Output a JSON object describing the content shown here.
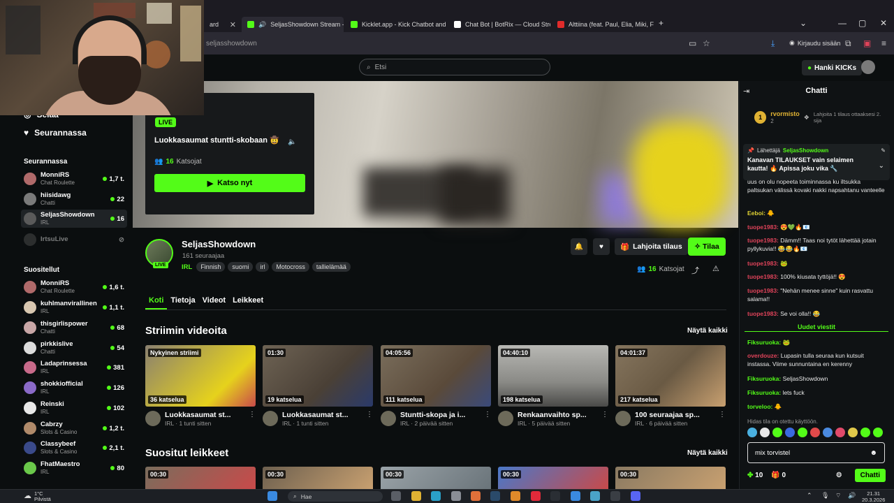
{
  "browser": {
    "tabs": [
      {
        "label": "ard",
        "color": "#888888"
      },
      {
        "label": "SeljasShowdown Stream - \\",
        "color": "#53fc18"
      },
      {
        "label": "Kicklet.app - Kick Chatbot and C",
        "color": "#53fc18"
      },
      {
        "label": "Chat Bot | BotRix — Cloud Strea",
        "color": "#ffffff"
      },
      {
        "label": "Alttiina (feat. Paul, Elia, Miki, Fre",
        "color": "#e02b2b"
      }
    ],
    "url": "seljasshowdown",
    "signin_label": "Kirjaudu sisään"
  },
  "header": {
    "search_placeholder": "Etsi",
    "get_kicks": "Hanki KICKs"
  },
  "sidebar": {
    "nav": [
      {
        "label": "Selaa",
        "icon": "compass-icon"
      },
      {
        "label": "Seurannassa",
        "icon": "heart-icon"
      }
    ],
    "following_title": "Seurannassa",
    "following": [
      {
        "name": "MonniRS",
        "category": "Chat Roulette",
        "count": "1,7 t.",
        "color": "#b06a6a"
      },
      {
        "name": "hiisidawg",
        "category": "Chatti",
        "count": "22",
        "color": "#7a7a7a"
      },
      {
        "name": "SeljasShowdown",
        "category": "IRL",
        "count": "16",
        "color": "#5a5a5a"
      },
      {
        "name": "IrtsuLive",
        "category": "",
        "count": "",
        "color": "#555555"
      }
    ],
    "recommended_title": "Suositellut",
    "recommended": [
      {
        "name": "MonniRS",
        "category": "Chat Roulette",
        "count": "1,6 t.",
        "color": "#b06a6a"
      },
      {
        "name": "kuhlmanvirallinen",
        "category": "IRL",
        "count": "1,1 t.",
        "color": "#d8c7b0"
      },
      {
        "name": "thisgirlispower",
        "category": "Chatti",
        "count": "68",
        "color": "#c8a6a6"
      },
      {
        "name": "pirkkislive",
        "category": "Chatti",
        "count": "54",
        "color": "#dcdcdc"
      },
      {
        "name": "Ladaprinsessa",
        "category": "IRL",
        "count": "381",
        "color": "#c86a8a"
      },
      {
        "name": "shokkiofficial",
        "category": "IRL",
        "count": "126",
        "color": "#8a6ac8"
      },
      {
        "name": "Reinski",
        "category": "IRL",
        "count": "102",
        "color": "#e8e8e8"
      },
      {
        "name": "Cabrzy",
        "category": "Slots & Casino",
        "count": "1,2 t.",
        "color": "#b08a6a"
      },
      {
        "name": "Classybeef",
        "category": "Slots & Casino",
        "count": "2,1 t.",
        "color": "#3a4a8a"
      },
      {
        "name": "FhatMaestro",
        "category": "IRL",
        "count": "80",
        "color": "#6ac84a"
      }
    ]
  },
  "live_card": {
    "badge": "LIVE",
    "title": "Luokkasaumat stuntti-skobaan 🤠",
    "viewers": "16",
    "viewers_label": "Katsojat",
    "watch_label": "Katso nyt"
  },
  "channel": {
    "name": "SeljasShowdown",
    "followers": "161 seuraajaa",
    "category": "IRL",
    "tags": [
      "Finnish",
      "suomi",
      "irl",
      "Motocross",
      "tallielämää"
    ],
    "live_badge": "LIVE",
    "gift_label": "Lahjoita tilaus",
    "subscribe_label": "Tilaa",
    "viewers": "16",
    "viewers_label": "Katsojat"
  },
  "page_tabs": [
    "Koti",
    "Tietoja",
    "Videot",
    "Leikkeet"
  ],
  "videos_section": {
    "title": "Striimin videoita",
    "show_all": "Näytä kaikki",
    "items": [
      {
        "duration": "Nykyinen striimi",
        "views": "36 katselua",
        "title": "Luokkasaumat st...",
        "meta": "IRL · 1 tunti sitten",
        "bg": "#8a8070"
      },
      {
        "duration": "01:30",
        "views": "19 katselua",
        "title": "Luokkasaumat st...",
        "meta": "IRL · 1 tunti sitten",
        "bg": "#6e6354"
      },
      {
        "duration": "04:05:56",
        "views": "111 katselua",
        "title": "Stuntti-skopa ja i...",
        "meta": "IRL · 2 päivää sitten",
        "bg": "#7a6e5c"
      },
      {
        "duration": "04:40:10",
        "views": "198 katselua",
        "title": "Renkaanvaihto sp...",
        "meta": "IRL · 5 päivää sitten",
        "bg": "#9a9a96"
      },
      {
        "duration": "04:01:37",
        "views": "217 katselua",
        "title": "100 seuraajaa sp...",
        "meta": "IRL · 6 päivää sitten",
        "bg": "#85755e"
      }
    ]
  },
  "clips_section": {
    "title": "Suositut leikkeet",
    "show_all": "Näytä kaikki",
    "items": [
      {
        "duration": "00:30",
        "bg": "#7a6d5c"
      },
      {
        "duration": "00:30",
        "bg": "#6d604f"
      },
      {
        "duration": "00:30",
        "bg": "#9aa3a8"
      },
      {
        "duration": "00:30",
        "bg": "#4a78c8"
      },
      {
        "duration": "00:30",
        "bg": "#8a7a62"
      }
    ]
  },
  "chat": {
    "title": "Chatti",
    "leader_name": "rvormisto",
    "leader_count": "2",
    "leader_rank": "1",
    "leader_text": "Lahjoita 1 tilaus ottaaksesi 2. sija",
    "pinned_by_label": "Lähettäjä",
    "pinned_by": "SeljasShowdown",
    "pinned_msg": "Kanavan TILAUKSET vain selaimen kautta! 🔥 Apissa joku vika 🔧",
    "messages": [
      {
        "user": "",
        "text": "uus on olu nopeeta toiminnassa ku iltsukka paltsukan välissä kovaki nakki napsahtanu vanteelle",
        "cls": "u-green"
      },
      {
        "user": "Eeboi:",
        "text": "🐥",
        "cls": "u-yellow"
      },
      {
        "user": "tuope1983:",
        "text": "😍💚🔥📧",
        "cls": "u-red"
      },
      {
        "user": "tuope1983:",
        "text": "Dämm!! Taas noi tytöt lähettää jotain pyllykuvia!! 😂😂🔥📧",
        "cls": "u-red"
      },
      {
        "user": "tuope1983:",
        "text": "🐸",
        "cls": "u-red"
      },
      {
        "user": "tuope1983:",
        "text": "100% kiusata tyttöjä!! 😍",
        "cls": "u-red"
      },
      {
        "user": "tuope1983:",
        "text": "\"Nehän menee sinne\" kuin rasvattu salama!!",
        "cls": "u-red"
      },
      {
        "user": "tuope1983:",
        "text": "Se voi olla!! 😂",
        "cls": "u-red"
      }
    ],
    "new_messages_label": "Uudet viestit",
    "new_messages": [
      {
        "user": "Fiksuruoka:",
        "text": "🐸",
        "cls": "u-green"
      },
      {
        "user": "overdouze:",
        "text": "Lupasin tulla seuraa kun kutsuit instassa. Viime sunnuntaina en kerenny",
        "cls": "u-red"
      },
      {
        "user": "Fiksuruoka:",
        "text": "SeljasShowdown",
        "cls": "u-green"
      },
      {
        "user": "Fiksuruoka:",
        "text": "lets fuck",
        "cls": "u-green"
      },
      {
        "user": "torveloo:",
        "text": "🐥",
        "cls": "u-green"
      }
    ],
    "slow_note": "Hidas tila on otettu käyttöön.",
    "input_value": "mix torvistel",
    "points": "10",
    "gifts": "0",
    "send_label": "Chatti"
  },
  "taskbar": {
    "temp": "1°C",
    "weather": "Pilvistä",
    "search": "Hae",
    "time": "21.31",
    "date": "20.3.2026"
  }
}
